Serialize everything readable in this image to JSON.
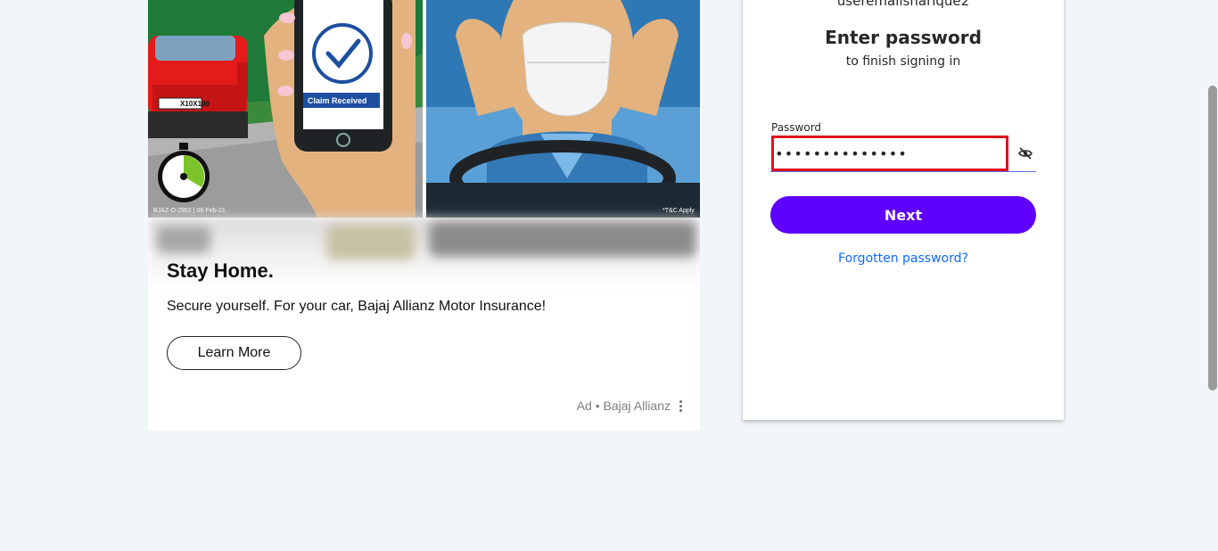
{
  "ad": {
    "image_left_caption": "BJAZ-O-2952 | 08-Feb-21",
    "image_right_caption": "*T&C Apply",
    "plate_text": "X10X100",
    "phone_badge": "Claim Received",
    "title": "Stay Home.",
    "description": "Secure yourself. For your car, Bajaj Allianz Motor Insurance!",
    "cta_label": "Learn More",
    "footer": "Ad • Bajaj Allianz",
    "menu_icon": "kebab-icon"
  },
  "login": {
    "username": "useremailsharique2",
    "heading": "Enter password",
    "subheading": "to finish signing in",
    "password_label": "Password",
    "password_value": "••••••••••••••",
    "show_password_icon": "eye-slash-icon",
    "next_label": "Next",
    "forgot_label": "Forgotten password?"
  },
  "colors": {
    "primary": "#5f01ff",
    "link": "#0f69ff",
    "error_border": "#e0111c",
    "page_bg": "#f1f6f9"
  }
}
